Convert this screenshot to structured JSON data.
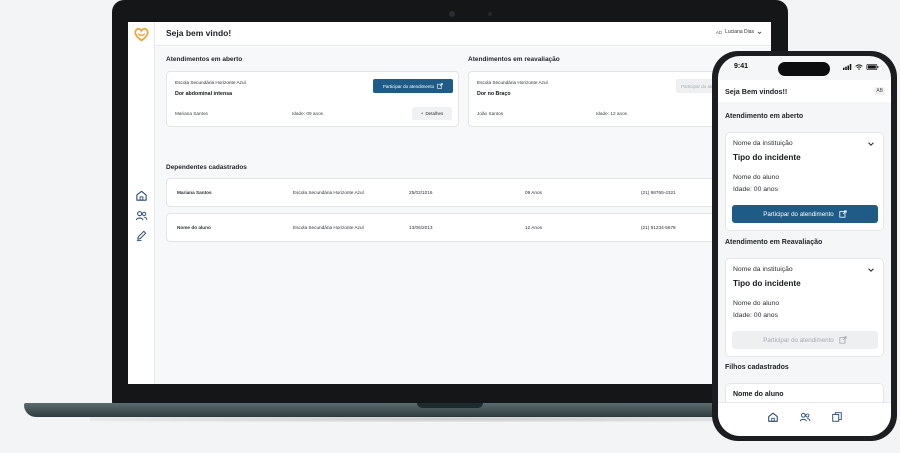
{
  "desktop": {
    "title": "Seja bem vindo!",
    "user": {
      "initials": "AD",
      "name": "Luciana Dias"
    },
    "open_section": {
      "title": "Atendimentos em aberto",
      "institution": "Escola Secundária Horizonte Azul",
      "incident": "Dor abdominal intensa",
      "student": "Mariana Santos",
      "age": "Idade: 09 anos",
      "participate_label": "Participar do atendimento",
      "details_label": "Detalhes"
    },
    "review_section": {
      "title": "Atendimentos em reavaliação",
      "institution": "Escola Secundária Horizonte Azul",
      "incident": "Dor no Braço",
      "student": "João Santos",
      "age": "Idade: 12 anos",
      "participate_label": "Participar do atend"
    },
    "dependents": {
      "title": "Dependentes cadastrados",
      "rows": [
        {
          "name": "Mariana Santos",
          "school": "Escola Secundária Horizonte Azul",
          "birth": "25/02/1016",
          "age": "09 Anos",
          "phone": "(21) 98765-4321"
        },
        {
          "name": "Nome do aluno",
          "school": "Escola Secundária Horizonte Azul",
          "birth": "13/06/2013",
          "age": "12 Anos",
          "phone": "(21) 91234-5678"
        }
      ]
    }
  },
  "mobile": {
    "status_time": "9:41",
    "title": "Seja Bem vindos!!",
    "badge": "AB",
    "open": {
      "title": "Atendimento em aberto",
      "institution": "Nome da instituição",
      "incident": "Tipo do incidente",
      "student": "Nome do aluno",
      "age": "Idade: 00 anos",
      "button": "Participar do atendimento"
    },
    "review": {
      "title": "Atendimento em Reavaliação",
      "institution": "Nome da instituição",
      "incident": "Tipo do incidente",
      "student": "Nome do aluno",
      "age": "Idade: 00 anos",
      "button": "Participar do atendimento"
    },
    "children": {
      "title": "Filhos cadastrados",
      "first": "Nome do aluno"
    }
  },
  "colors": {
    "primary": "#1f5b87",
    "logo": "#f0a232",
    "nav": "#2d4e72"
  }
}
